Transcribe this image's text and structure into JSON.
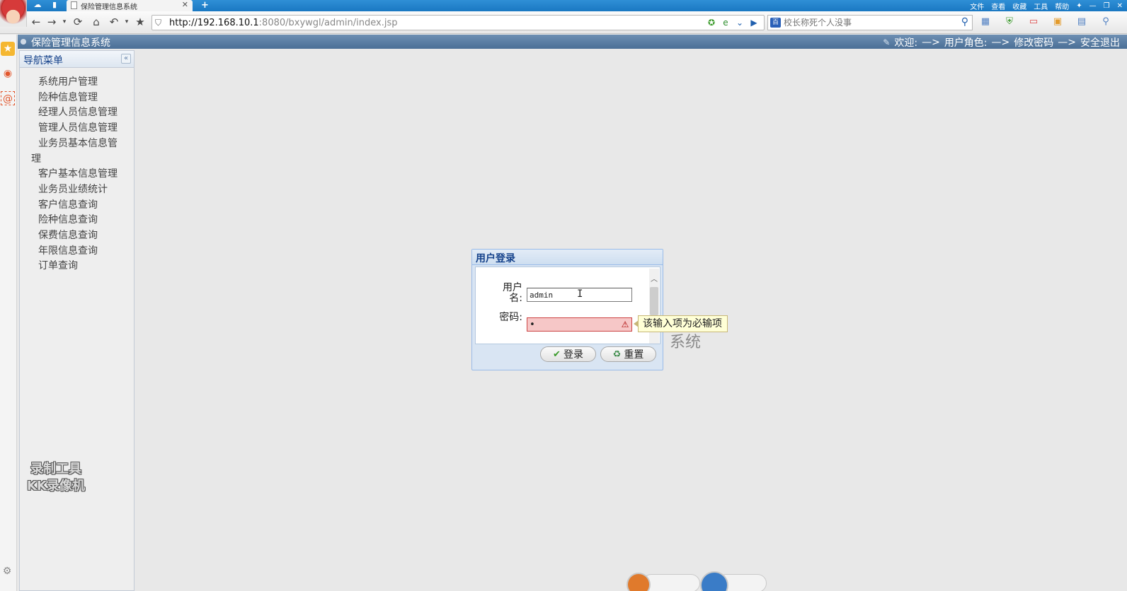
{
  "browser": {
    "tab_title": "保险管理信息系统",
    "tab_close": "✕",
    "new_tab": "+",
    "menus": [
      "文件",
      "查看",
      "收藏",
      "工具",
      "帮助"
    ],
    "url_host": "http://192.168.10.1",
    "url_path": ":8080/bxywgl/admin/index.jsp",
    "search_placeholder": "校长称死个人没事"
  },
  "header": {
    "title": "保险管理信息系统",
    "welcome": "欢迎:",
    "arrow": "—>",
    "role": "用户角色:",
    "change_password": "修改密码",
    "logout": "安全退出"
  },
  "nav": {
    "title": "导航菜单",
    "collapse": "«",
    "items": [
      "系统用户管理",
      "险种信息管理",
      "经理人员信息管理",
      "管理人员信息管理",
      "业务员基本信息管理",
      "客户基本信息管理",
      "业务员业绩统计",
      "客户信息查询",
      "险种信息查询",
      "保费信息查询",
      "年限信息查询",
      "订单查询"
    ]
  },
  "watermark": {
    "line1": "录制工具",
    "line2": "KK录像机"
  },
  "behind_text": "系统",
  "login": {
    "title": "用户登录",
    "username_label": "用户名:",
    "username_value": "admin",
    "password_label": "密码:",
    "password_value": "•",
    "login_button": "登录",
    "reset_button": "重置",
    "required_tip": "该输入项为必输项"
  },
  "icons": {
    "back": "back-arrow-icon",
    "forward": "forward-arrow-icon",
    "refresh": "refresh-icon",
    "home": "home-icon",
    "undo": "undo-icon",
    "favorite": "star-icon",
    "warning": "warning-icon"
  },
  "colors": {
    "header_bar": "#5a7ea5",
    "tab_strip": "#2486cf",
    "nav_title": "#15428b",
    "invalid_field": "#f6c7c7",
    "tooltip": "#ffffd6"
  }
}
